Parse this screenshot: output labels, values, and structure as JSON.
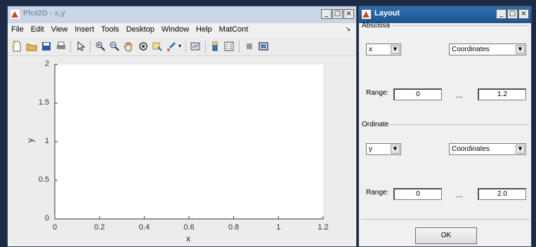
{
  "plot_window": {
    "title": "Plot2D - x,y",
    "menu": [
      "File",
      "Edit",
      "View",
      "Insert",
      "Tools",
      "Desktop",
      "Window",
      "Help",
      "MatCont"
    ],
    "menu_arrow": "↘"
  },
  "chart_data": {
    "type": "line",
    "x": [],
    "series": [],
    "xlabel": "x",
    "ylabel": "y",
    "xlim": [
      0,
      1.2
    ],
    "ylim": [
      0,
      2
    ],
    "xticks": [
      "0",
      "0.2",
      "0.4",
      "0.6",
      "0.8",
      "1",
      "1.2"
    ],
    "yticks": [
      "0",
      "0.5",
      "1",
      "1.5",
      "2"
    ],
    "grid": false
  },
  "layout_window": {
    "title": "Layout",
    "abscissa": {
      "legend": "Abscissa",
      "variable": "x",
      "type": "Coordinates",
      "range_label": "Range:",
      "range_min": "0",
      "range_max": "1.2",
      "range_sep": "..."
    },
    "ordinate": {
      "legend": "Ordinate",
      "variable": "y",
      "type": "Coordinates",
      "range_label": "Range:",
      "range_min": "0",
      "range_max": "2.0",
      "range_sep": "..."
    },
    "ok_label": "OK"
  },
  "window_buttons": {
    "minimize": "_",
    "maximize": "□",
    "close": "×"
  }
}
